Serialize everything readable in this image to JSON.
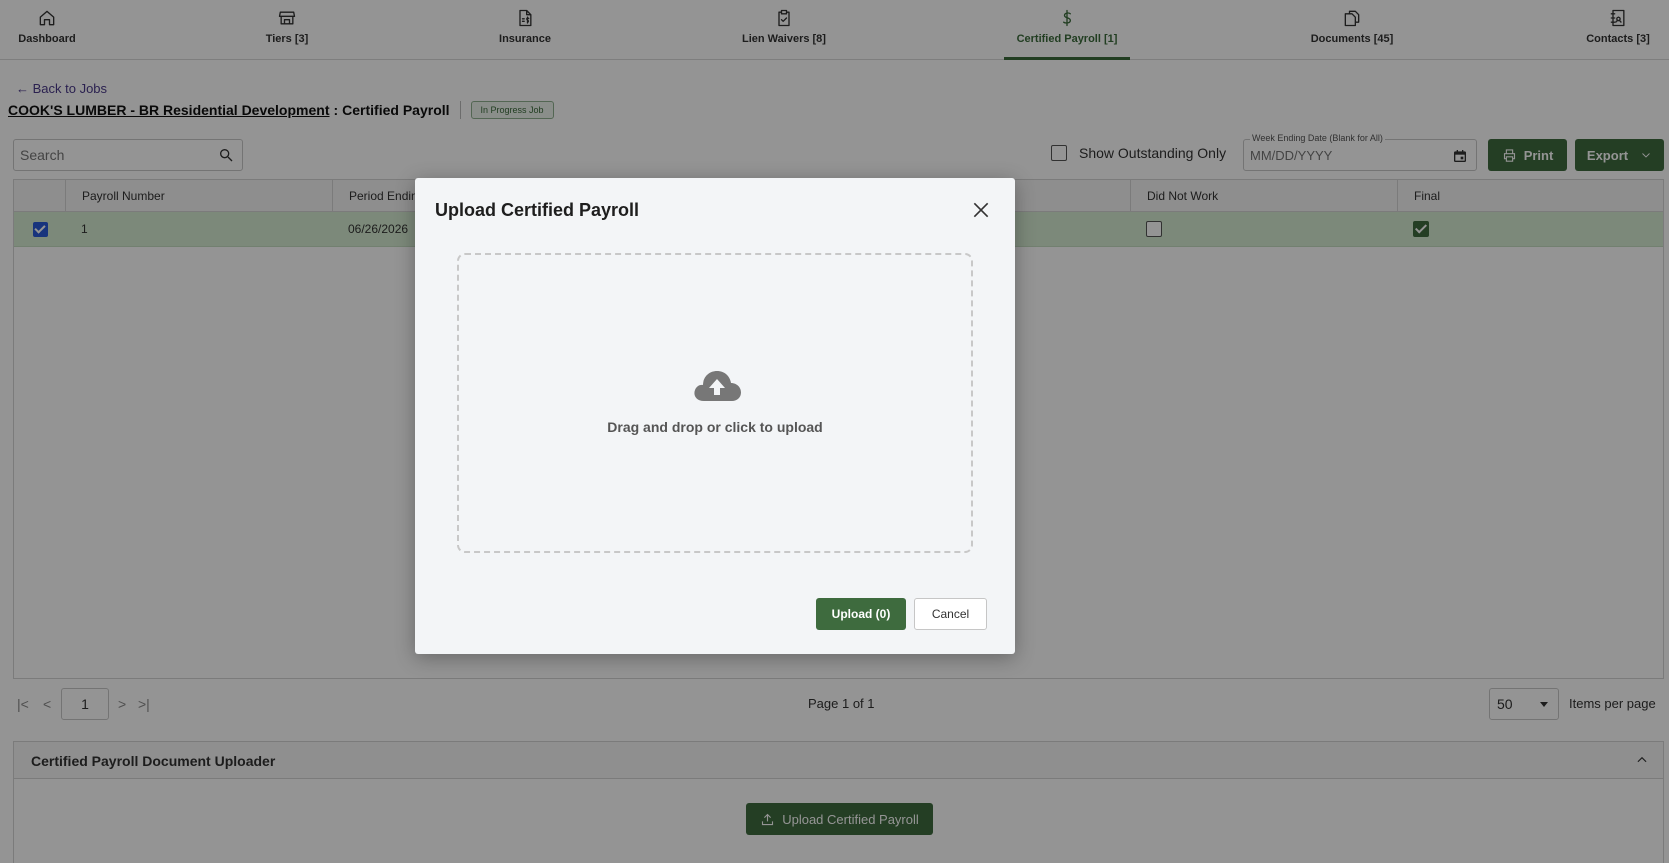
{
  "nav": {
    "items": [
      {
        "label": "Dashboard",
        "icon": "home-icon"
      },
      {
        "label": "Tiers [3]",
        "icon": "store-icon"
      },
      {
        "label": "Insurance",
        "icon": "document-dollar-icon"
      },
      {
        "label": "Lien Waivers [8]",
        "icon": "clipboard-check-icon"
      },
      {
        "label": "Certified Payroll [1]",
        "icon": "dollar-icon"
      },
      {
        "label": "Documents [45]",
        "icon": "copy-files-icon"
      },
      {
        "label": "Contacts [3]",
        "icon": "address-book-icon"
      }
    ],
    "active_index": 4
  },
  "back_link": "← Back to Jobs",
  "page": {
    "job": "COOK'S LUMBER - BR Residential Development",
    "separator": ":",
    "section": "Certified Payroll",
    "badge": "In Progress Job"
  },
  "toolbar": {
    "search_placeholder": "Search",
    "show_outstanding_label": "Show Outstanding Only",
    "date_label": "Week Ending Date (Blank for All)",
    "date_placeholder": "MM/DD/YYYY",
    "print_label": "Print",
    "export_label": "Export"
  },
  "table": {
    "columns": [
      "Payroll Number",
      "Period Ending",
      "Did Not Work",
      "Final"
    ],
    "rows": [
      {
        "selected": true,
        "payroll_number": "1",
        "period_ending": "06/26/2026",
        "did_not_work": false,
        "final": true
      }
    ]
  },
  "pager": {
    "page_input": "1",
    "page_text": "Page 1 of 1",
    "page_size": "50",
    "items_per_page": "Items per page"
  },
  "uploader_panel": {
    "title": "Certified Payroll Document Uploader",
    "button_label": "Upload Certified Payroll"
  },
  "modal": {
    "title": "Upload Certified Payroll",
    "dropzone_text": "Drag and drop or click to upload",
    "upload_label": "Upload (0)",
    "cancel_label": "Cancel"
  },
  "colors": {
    "brand_green": "#3e6b3e",
    "row_highlight": "#d6ecd2",
    "checkbox_blue": "#2a5bd7"
  }
}
